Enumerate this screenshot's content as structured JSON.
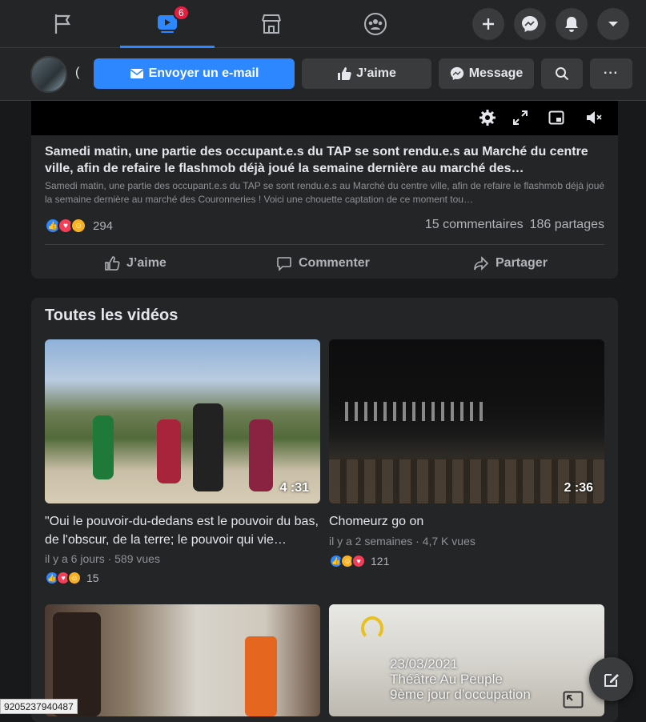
{
  "topnav": {
    "tabs": [
      {
        "icon": "flag-icon"
      },
      {
        "icon": "watch-video-icon",
        "badge": "6"
      },
      {
        "icon": "marketplace-icon"
      },
      {
        "icon": "groups-icon"
      }
    ],
    "actions": [
      "create-plus-icon",
      "messenger-icon",
      "notifications-bell-icon",
      "account-menu-chevron-icon"
    ]
  },
  "pagebar": {
    "name_fragment": "(",
    "email_button": "Envoyer un e-mail",
    "like_button": "J’aime",
    "message_button": "Message",
    "more_label": "···"
  },
  "post": {
    "title": "Samedi matin, une partie des occupant.e.s du TAP se sont rendu.e.s au Marché du centre ville, afin de refaire le flashmob déjà joué la semaine dernière au marché des…",
    "description": "Samedi matin, une partie des occupant.e.s du TAP se sont rendu.e.s au Marché du centre ville, afin de refaire le flashmob déjà joué la semaine dernière au marché des Couronneries ! Voici une chouette captation de ce moment tou…",
    "reaction_count": "294",
    "comments": "15 commentaires",
    "shares": "186 partages",
    "like_action": "J’aime",
    "comment_action": "Commenter",
    "share_action": "Partager"
  },
  "all_videos": {
    "title": "Toutes les vidéos",
    "videos": [
      {
        "duration": "4 :31",
        "title": "\"Oui le pouvoir-du-dedans est le pouvoir du bas, de l'obscur, de la terre; le pouvoir qui vie…",
        "meta": "il y a 6 jours · 589 vues",
        "reactions": "15"
      },
      {
        "duration": "2 :36",
        "title": "Chomeurz go on",
        "meta": "il y a 2 semaines · 4,7 K vues",
        "reactions": "121"
      },
      {
        "overlay": ""
      },
      {
        "overlay_date": "23/03/2021",
        "overlay_place": "Théâtre Au Peuple",
        "overlay_day": "9ème jour d’occupation"
      }
    ]
  },
  "status_url": "9205237940487",
  "colors": {
    "accent": "#2d88ff",
    "badge": "#e41e3f",
    "bg": "#18191a",
    "card": "#242526"
  }
}
